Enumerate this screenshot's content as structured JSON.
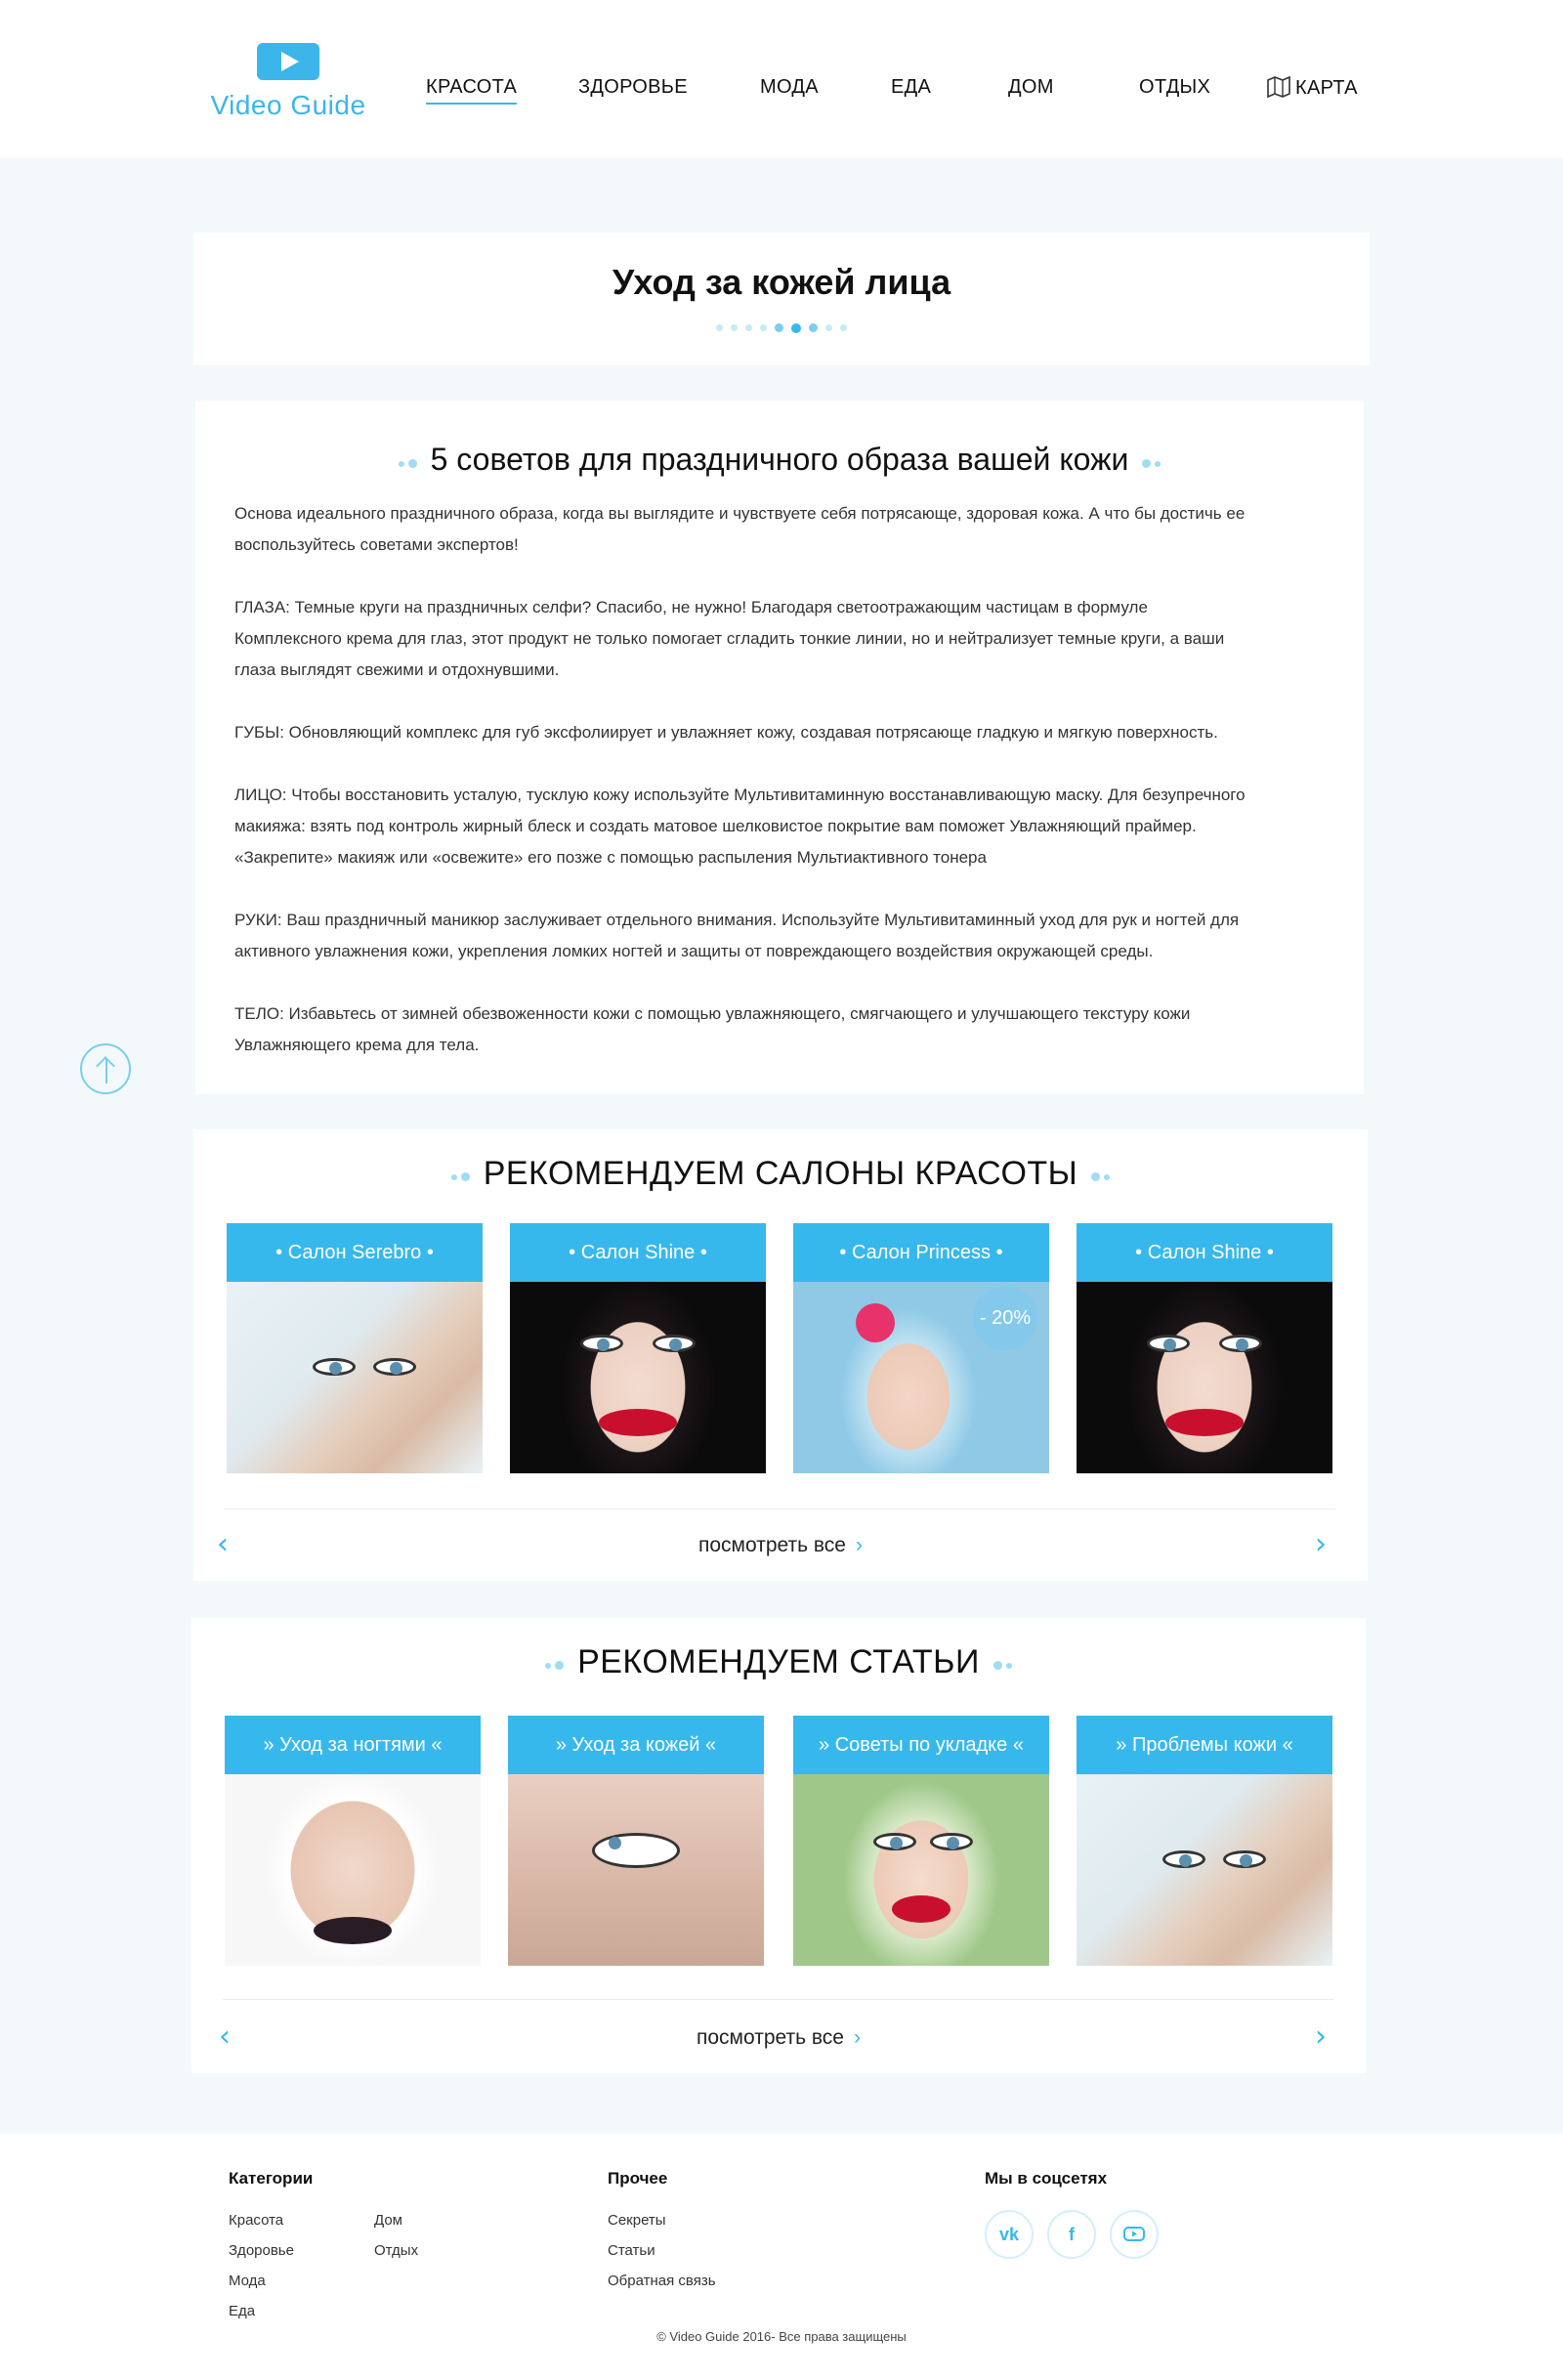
{
  "header": {
    "logo_text": "Video Guide",
    "nav": [
      "КРАСОТА",
      "ЗДОРОВЬЕ",
      "МОДА",
      "ЕДА",
      "ДОМ",
      "ОТДЫХ"
    ],
    "map_label": "КАРТА"
  },
  "page": {
    "title": "Уход за кожей лица",
    "pager_count": 9,
    "pager_active": 5
  },
  "article": {
    "heading": "5 советов для праздничного образа вашей кожи",
    "intro_1": "Основа идеального праздничного образа, когда вы выглядите и чувствуете себя потрясающе, здоровая кожа. А что бы достичь ее",
    "intro_2": "воспользуйтесь советами экспертов!",
    "eyes_1": "ГЛАЗА: Темные круги на праздничных селфи? Спасибо, не нужно! Благодаря светоотражающим частицам в формуле",
    "eyes_2": "Комплексного крема для глаз, этот продукт не только помогает сгладить тонкие линии, но и нейтрализует темные круги, а ваши",
    "eyes_3": "глаза выглядят свежими и отдохнувшими.",
    "lips_1": "ГУБЫ:  Обновляющий комплекс для губ эксфолиирует и увлажняет кожу, создавая потрясающе гладкую и мягкую поверхность.",
    "face_1": "ЛИЦО: Чтобы восстановить  усталую, тусклую кожу используйте Мультивитаминную восстанавливающую маску.  Для безупречного",
    "face_2": "макияжа: взять под контроль жирный блеск и создать матовое шелковистое покрытие вам поможет  Увлажняющий праймер.",
    "face_3": "«Закрепите» макияж или «освежите» его позже с помощью распыления  Мультиактивного тонера",
    "hands_1": "РУКИ: Ваш праздничный маникюр заслуживает отдельного внимания. Используйте  Мультивитаминный уход для рук и ногтей для",
    "hands_2": "активного увлажнения кожи, укрепления ломких ногтей и защиты от повреждающего воздействия окружающей среды.",
    "body_1": "ТЕЛО: Избавьтесь от зимней обезвоженности кожи с помощью увлажняющего, смягчающего и улучшающего текстуру кожи",
    "body_2": "Увлажняющего крема для тела."
  },
  "salons": {
    "heading": "РЕКОМЕНДУЕМ САЛОНЫ КРАСОТЫ",
    "cards": [
      "• Салон Serebro •",
      "• Салон Shine •",
      "• Салон Princess •",
      "• Салон Shine •"
    ],
    "discount": "- 20%",
    "view_all": "посмотреть все"
  },
  "articles": {
    "heading": "РЕКОМЕНДУЕМ СТАТЬИ",
    "cards": [
      "» Уход за ногтями «",
      "» Уход за кожей «",
      "» Советы по укладке «",
      "» Проблемы кожи «"
    ],
    "view_all": "посмотреть все"
  },
  "footer": {
    "categories_title": "Категории",
    "categories_col1": [
      "Красота",
      "Здоровье",
      "Мода",
      "Еда"
    ],
    "categories_col2": [
      "Дом",
      "Отдых"
    ],
    "other_title": "Прочее",
    "other_links": [
      "Секреты",
      "Статьи",
      "Обратная связь"
    ],
    "social_title": "Мы в соцсетях",
    "social": [
      "vk-icon",
      "facebook-icon",
      "youtube-icon"
    ],
    "copyright": "© Video Guide  2016- Все права защищены"
  },
  "colors": {
    "accent": "#37b8ec",
    "background": "#f3f9fb"
  }
}
